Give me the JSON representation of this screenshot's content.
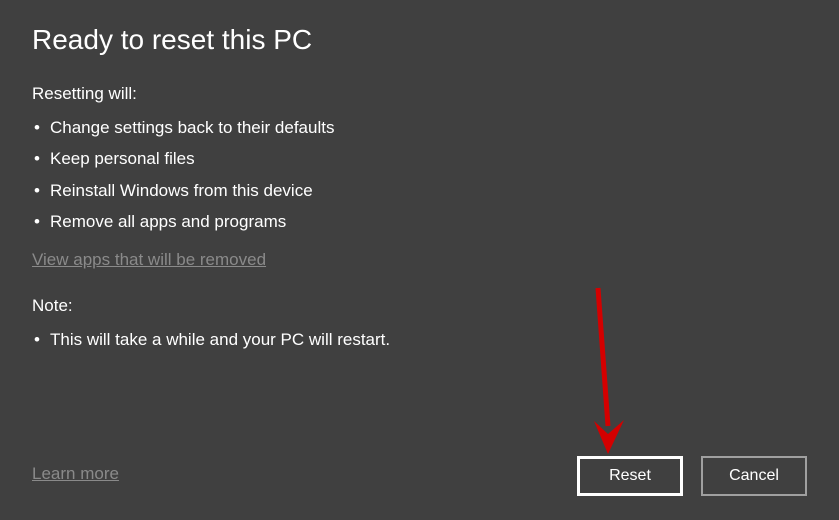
{
  "title": "Ready to reset this PC",
  "resetting": {
    "label": "Resetting will:",
    "items": [
      "Change settings back to their defaults",
      "Keep personal files",
      "Reinstall Windows from this device",
      "Remove all apps and programs"
    ]
  },
  "view_apps_link": "View apps that will be removed",
  "note": {
    "label": "Note:",
    "items": [
      "This will take a while and your PC will restart."
    ]
  },
  "learn_more": "Learn more",
  "buttons": {
    "reset": "Reset",
    "cancel": "Cancel"
  }
}
